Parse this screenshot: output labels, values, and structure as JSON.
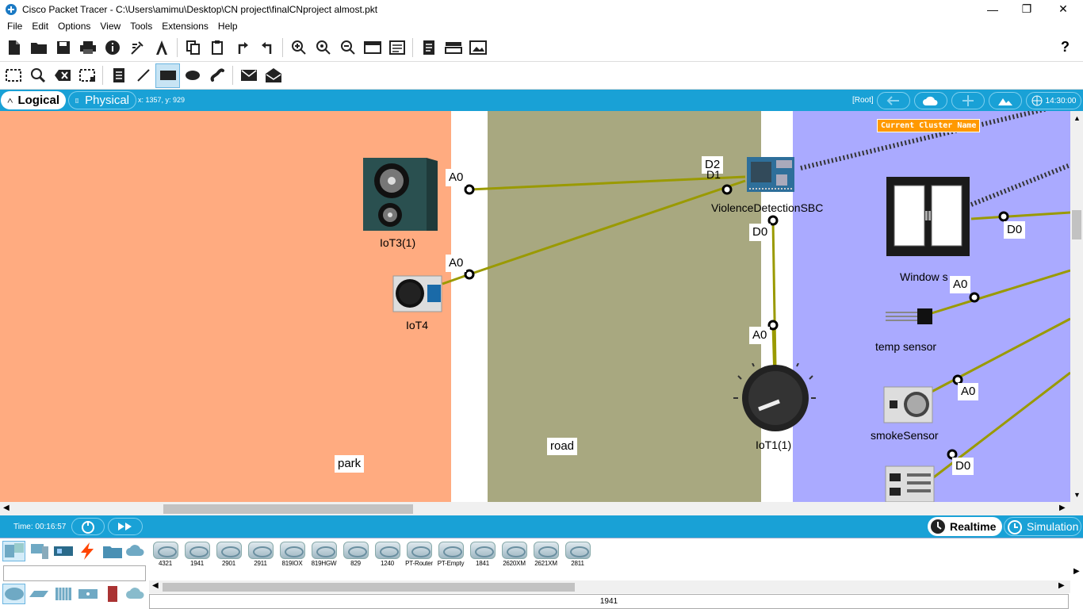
{
  "window": {
    "title": "Cisco Packet Tracer - C:\\Users\\amimu\\Desktop\\CN project\\finalCNproject almost.pkt",
    "minimize": "—",
    "restore": "❐",
    "close": "✕"
  },
  "menu": [
    "File",
    "Edit",
    "Options",
    "View",
    "Tools",
    "Extensions",
    "Help"
  ],
  "toolbar1": {
    "icons": [
      "new-file-icon",
      "open-folder-icon",
      "save-icon",
      "print-icon",
      "info-icon",
      "network-wizard-icon",
      "activity-wizard-icon",
      "copy-icon",
      "paste-icon",
      "undo-icon",
      "redo-icon",
      "zoom-in-icon",
      "zoom-reset-icon",
      "zoom-out-icon",
      "drawing-palette-icon",
      "custom-devices-icon",
      "notes-icon",
      "view-messages-icon",
      "screenshot-icon"
    ],
    "help": "?"
  },
  "toolbar2": {
    "icons": [
      "select-icon",
      "inspect-icon",
      "delete-icon",
      "resize-icon",
      "note-icon",
      "line-icon",
      "rectangle-icon",
      "ellipse-icon",
      "freeform-icon",
      "simple-pdu-icon",
      "complex-pdu-icon"
    ]
  },
  "modebar": {
    "logical": "Logical",
    "physical": "Physical",
    "coords": "x: 1357, y: 929",
    "root": "[Root]",
    "clock": "14:30:00"
  },
  "canvas": {
    "cluster_label": "Current Cluster Name",
    "zones": {
      "park": "park",
      "road": "road"
    },
    "devices": {
      "iot3": "IoT3(1)",
      "iot4": "IoT4",
      "sbc": "ViolenceDetectionSBC",
      "iot1": "IoT1(1)",
      "window": "Window s",
      "temp": "temp sensor",
      "smoke": "smokeSensor"
    },
    "ports": {
      "p_a0_iot3": "A0",
      "p_a0_iot4": "A0",
      "p_d2": "D2",
      "p_d1": "D1",
      "p_d0_sbc": "D0",
      "p_a0_iot1": "A0",
      "p_d0_window": "D0",
      "p_a0_temp": "A0",
      "p_a0_smoke": "A0",
      "p_d0_bottom": "D0"
    }
  },
  "timebar": {
    "time": "Time: 00:16:57",
    "realtime": "Realtime",
    "simulation": "Simulation"
  },
  "devices_panel": {
    "routers": [
      "4321",
      "1941",
      "2901",
      "2911",
      "819IOX",
      "819HGW",
      "829",
      "1240",
      "PT-Router",
      "PT-Empty",
      "1841",
      "2620XM",
      "2621XM",
      "2811"
    ],
    "selected": "1941"
  },
  "colors": {
    "accent": "#19a1d6",
    "park": "#ffab80",
    "road": "#a8a880",
    "zone3": "#aaaaff",
    "cable": "#9a9a00",
    "cluster": "#ff9900"
  }
}
